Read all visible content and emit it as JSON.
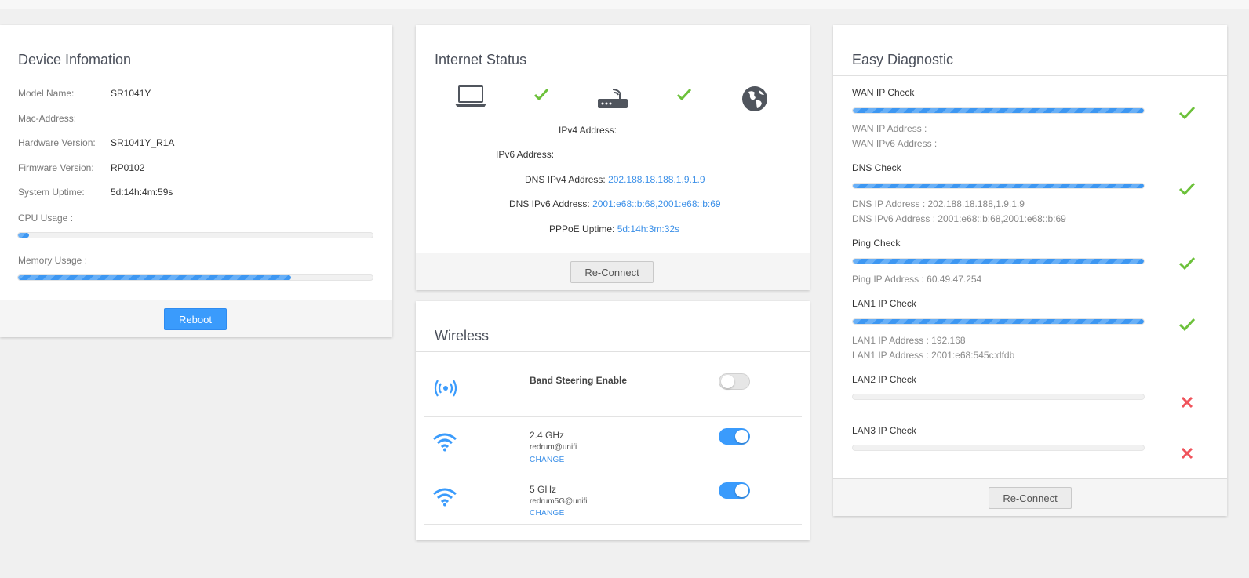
{
  "device": {
    "title": "Device Infomation",
    "rows": [
      {
        "label": "Model Name:",
        "value": "SR1041Y"
      },
      {
        "label": "Mac-Address:",
        "value": ""
      },
      {
        "label": "Hardware Version:",
        "value": "SR1041Y_R1A"
      },
      {
        "label": "Firmware Version:",
        "value": "RP0102"
      },
      {
        "label": "System Uptime:",
        "value": "5d:14h:4m:59s"
      }
    ],
    "cpu_label": "CPU Usage :",
    "cpu_percent": 3,
    "memory_label": "Memory Usage :",
    "memory_percent": 77,
    "reboot_label": "Reboot"
  },
  "internet": {
    "title": "Internet Status",
    "ipv4_label": "IPv4 Address:",
    "ipv4_value": "",
    "ipv6_label": "IPv6 Address:",
    "ipv6_value": "",
    "dns4_label": "DNS IPv4 Address:",
    "dns4_value": "202.188.18.188,1.9.1.9",
    "dns6_label": "DNS IPv6 Address:",
    "dns6_value": "2001:e68::b:68,2001:e68::b:69",
    "pppoe_label": "PPPoE Uptime:",
    "pppoe_value": "5d:14h:3m:32s",
    "reconnect_label": "Re-Connect",
    "icons": [
      "laptop-icon",
      "check-icon",
      "router-icon",
      "check-icon",
      "globe-icon"
    ]
  },
  "wireless": {
    "title": "Wireless",
    "band_steering_label": "Band Steering Enable",
    "band_steering_on": false,
    "bands": [
      {
        "name": "2.4 GHz",
        "ssid": "redrum@unifi",
        "change": "CHANGE",
        "enabled": true
      },
      {
        "name": "5 GHz",
        "ssid": "redrum5G@unifi",
        "change": "CHANGE",
        "enabled": true
      }
    ]
  },
  "diagnostic": {
    "title": "Easy Diagnostic",
    "checks": [
      {
        "name": "WAN IP Check",
        "progress": 100,
        "status": "pass",
        "details": [
          "WAN IP Address :",
          "WAN IPv6 Address :"
        ]
      },
      {
        "name": "DNS Check",
        "progress": 100,
        "status": "pass",
        "details": [
          "DNS IP Address : 202.188.18.188,1.9.1.9",
          "DNS IPv6 Address : 2001:e68::b:68,2001:e68::b:69"
        ]
      },
      {
        "name": "Ping Check",
        "progress": 100,
        "status": "pass",
        "details": [
          "Ping IP Address : 60.49.47.254"
        ]
      },
      {
        "name": "LAN1 IP Check",
        "progress": 100,
        "status": "pass",
        "details": [
          "LAN1 IP Address : 192.168",
          "LAN1 IP Address : 2001:e68:545c:dfdb"
        ]
      },
      {
        "name": "LAN2 IP Check",
        "progress": 0,
        "status": "fail",
        "details": []
      },
      {
        "name": "LAN3 IP Check",
        "progress": 0,
        "status": "fail",
        "details": []
      }
    ],
    "reconnect_label": "Re-Connect"
  },
  "colors": {
    "accent": "#3a9bfc",
    "link": "#3c90e8",
    "success": "#6cc13a",
    "error": "#f0545c"
  }
}
